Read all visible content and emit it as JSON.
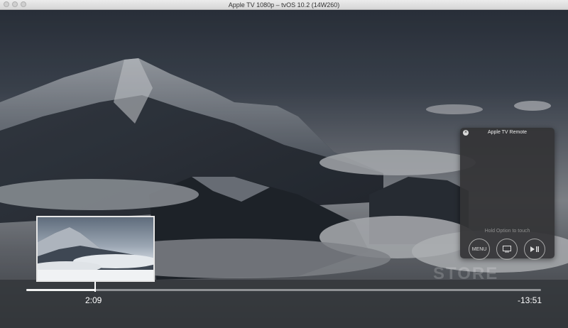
{
  "window": {
    "title": "Apple TV 1080p – tvOS 10.2 (14W260)"
  },
  "player": {
    "elapsed": "2:09",
    "remaining": "-13:51",
    "progress": 0.135,
    "watermark": "STORE"
  },
  "remote": {
    "title": "Apple TV Remote",
    "hint": "Hold Option to touch",
    "menu_label": "MENU",
    "tv_icon": "tv-icon",
    "play_icon": "play-pause-icon"
  },
  "colors": {
    "panel_bg": "#343436",
    "scrub_fill": "#f2f2f2"
  }
}
